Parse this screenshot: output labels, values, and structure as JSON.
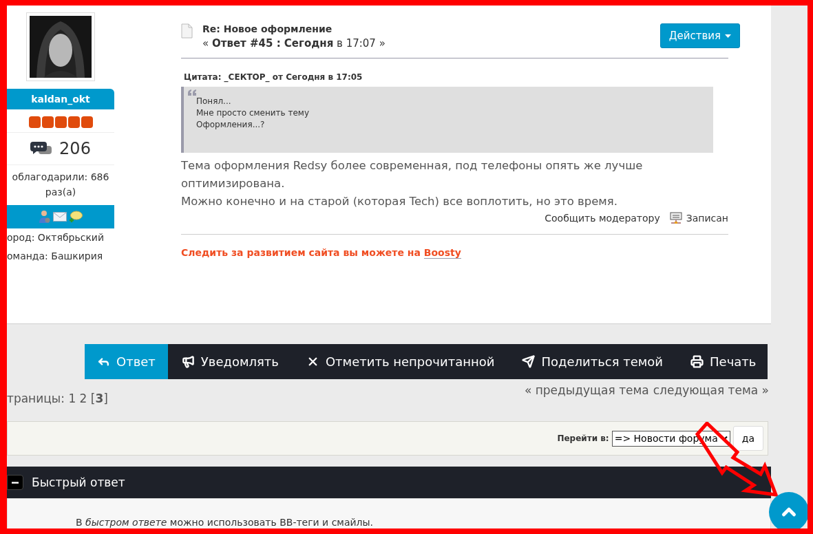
{
  "profile": {
    "username": "kaldan_okt",
    "stars": 5,
    "post_count": "206",
    "thanks": "облагодарили: 686 раз(а)",
    "fields": [
      "ород: Октябрьский",
      "оманда: Башкирия"
    ]
  },
  "post": {
    "title": "Re: Новое оформление",
    "subtitle": "« **Ответ #45 : Сегодня** в 17:07 »",
    "actions_button": "Действия",
    "quote": {
      "header": "Цитата: _СЕКТОР_ от Сегодня в 17:05",
      "lines": [
        "Понял...",
        "Мне просто сменить тему",
        "Оформления...?"
      ]
    },
    "body": [
      "Тема оформления Redsy более современная, под телефоны опять же лучше оптимизирована.",
      "Можно конечно и на старой (которая Tech) все воплотить, но это время."
    ],
    "report_link": "Сообщить модератору",
    "status": "Записан"
  },
  "notice": {
    "text": "Следить за развитием сайта вы можете на",
    "link": "Boosty"
  },
  "toolbar": [
    {
      "label": "Ответ",
      "selected": true
    },
    {
      "label": "Уведомлять",
      "selected": false
    },
    {
      "label": "Отметить непрочитанной",
      "selected": false
    },
    {
      "label": "Поделиться темой",
      "selected": false
    },
    {
      "label": "Печать",
      "selected": false
    }
  ],
  "pages": "траницы: 1 2 [**3**]",
  "topic_nav": [
    "« предыдущая тема",
    "следующая тема »"
  ],
  "jump": {
    "label": "Перейти в:",
    "value": "=> Новости форума",
    "button": "да"
  },
  "quick_reply": {
    "title": "Быстрый ответ",
    "expanded": true,
    "hint": "В *быстром ответе* можно использовать BB-теги и смайлы."
  }
}
